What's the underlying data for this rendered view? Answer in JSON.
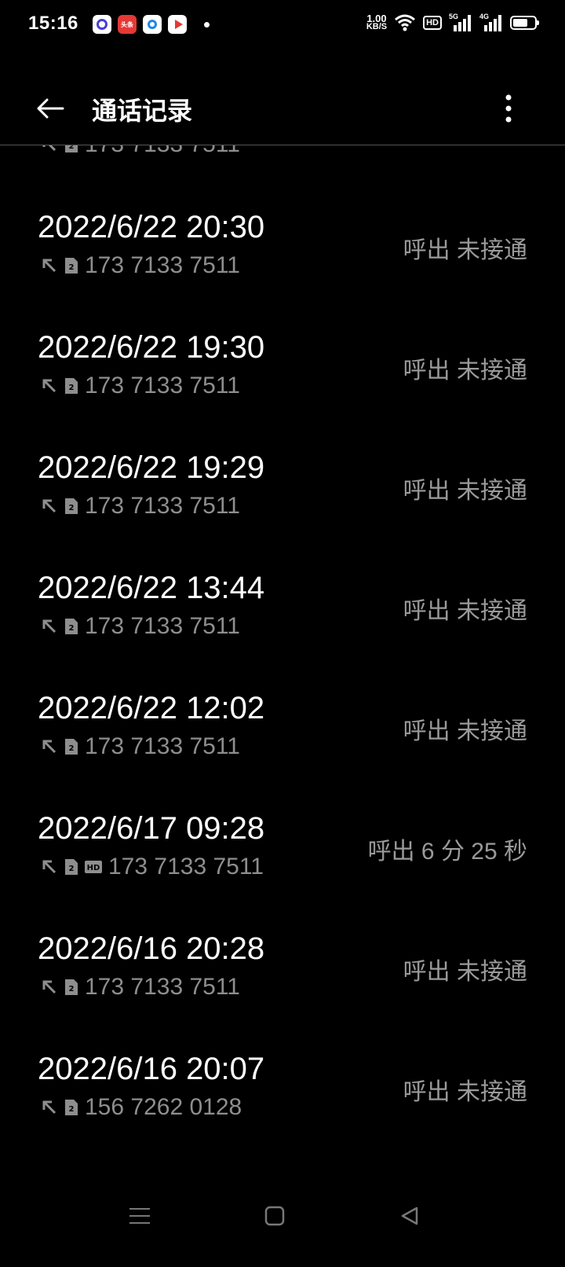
{
  "status_bar": {
    "time": "15:16",
    "net_speed_value": "1.00",
    "net_speed_unit": "KB/S",
    "hd_label": "HD",
    "signal_1_label": "5G",
    "signal_2_label": "4G",
    "app_b_label": "头条"
  },
  "header": {
    "title": "通话记录"
  },
  "partial_row": {
    "number": "173 7133 7511"
  },
  "call_log": [
    {
      "time": "2022/6/22 20:30",
      "number": "173 7133 7511",
      "status": "呼出 未接通",
      "hd": false
    },
    {
      "time": "2022/6/22 19:30",
      "number": "173 7133 7511",
      "status": "呼出 未接通",
      "hd": false
    },
    {
      "time": "2022/6/22 19:29",
      "number": "173 7133 7511",
      "status": "呼出 未接通",
      "hd": false
    },
    {
      "time": "2022/6/22 13:44",
      "number": "173 7133 7511",
      "status": "呼出 未接通",
      "hd": false
    },
    {
      "time": "2022/6/22 12:02",
      "number": "173 7133 7511",
      "status": "呼出 未接通",
      "hd": false
    },
    {
      "time": "2022/6/17 09:28",
      "number": "173 7133 7511",
      "status": "呼出  6 分 25 秒",
      "hd": true
    },
    {
      "time": "2022/6/16 20:28",
      "number": "173 7133 7511",
      "status": "呼出 未接通",
      "hd": false
    },
    {
      "time": "2022/6/16 20:07",
      "number": "156 7262 0128",
      "status": "呼出 未接通",
      "hd": false
    }
  ],
  "icons": {
    "outgoing": "outgoing-arrow-icon",
    "sim": "sim-2-icon",
    "hd": "hd-call-icon",
    "back": "back-arrow-icon",
    "more": "more-vert-icon"
  },
  "colors": {
    "background": "#000000",
    "primary_text": "#ffffff",
    "secondary_text": "#8e8e8e"
  }
}
